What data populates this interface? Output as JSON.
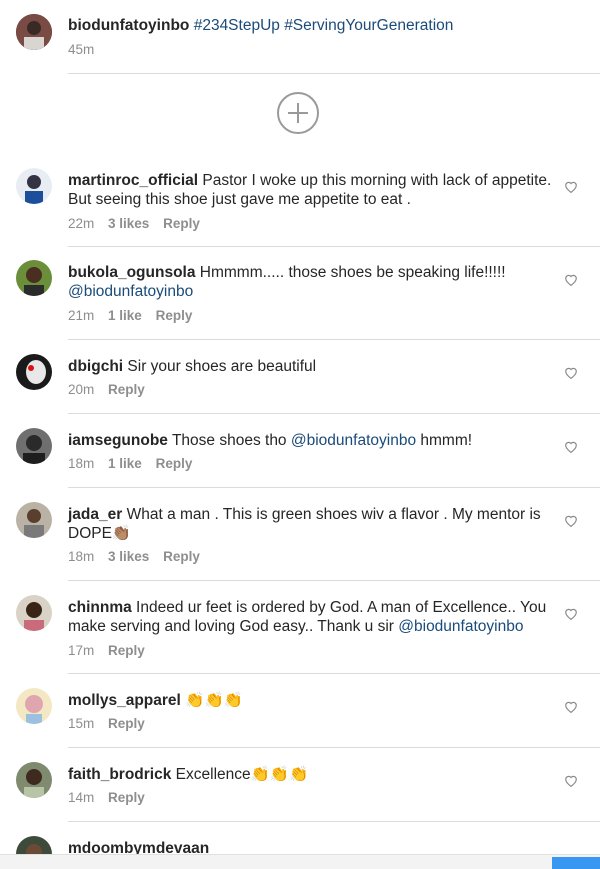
{
  "post": {
    "username": "biodunfatoyinbo",
    "caption": "#234StepUp #ServingYourGeneration",
    "time": "45m"
  },
  "load_more": {
    "icon": "plus-circle-icon"
  },
  "comments": [
    {
      "username": "martinroc_official",
      "text": "Pastor I woke up this morning with lack of appetite. But seeing this shoe just gave me appetite to eat .",
      "time": "22m",
      "likes": "3 likes",
      "reply": "Reply"
    },
    {
      "username": "bukola_ogunsola",
      "text": "Hmmmm..... those shoes be speaking life!!!!! ",
      "mention": "@biodunfatoyinbo",
      "time": "21m",
      "likes": "1 like",
      "reply": "Reply"
    },
    {
      "username": "dbigchi",
      "text": "Sir your shoes are beautiful",
      "time": "20m",
      "reply": "Reply"
    },
    {
      "username": "iamsegunobe",
      "text": "Those shoes tho ",
      "mention": "@biodunfatoyinbo",
      "text_after": " hmmm!",
      "time": "18m",
      "likes": "1 like",
      "reply": "Reply"
    },
    {
      "username": "jada_er",
      "text": "What a man . This is green shoes wiv a flavor . My mentor is DOPE👏🏽",
      "time": "18m",
      "likes": "3 likes",
      "reply": "Reply"
    },
    {
      "username": "chinnma",
      "text": "Indeed ur feet is ordered by God. A man of Excellence.. You make serving and loving God easy.. Thank u sir ",
      "mention": "@biodunfatoyinbo",
      "time": "17m",
      "reply": "Reply"
    },
    {
      "username": "mollys_apparel",
      "text": "👏👏👏",
      "time": "15m",
      "reply": "Reply"
    },
    {
      "username": "faith_brodrick",
      "text": "Excellence👏👏👏",
      "time": "14m",
      "reply": "Reply"
    },
    {
      "username": "mdoombymdevaan",
      "text": ""
    }
  ],
  "icons": {
    "like": "heart-icon"
  },
  "colors": {
    "hashtag": "#1a4b7a",
    "meta": "#8e8e8e",
    "separator": "#dbdbdb",
    "accent": "#3897f0"
  }
}
